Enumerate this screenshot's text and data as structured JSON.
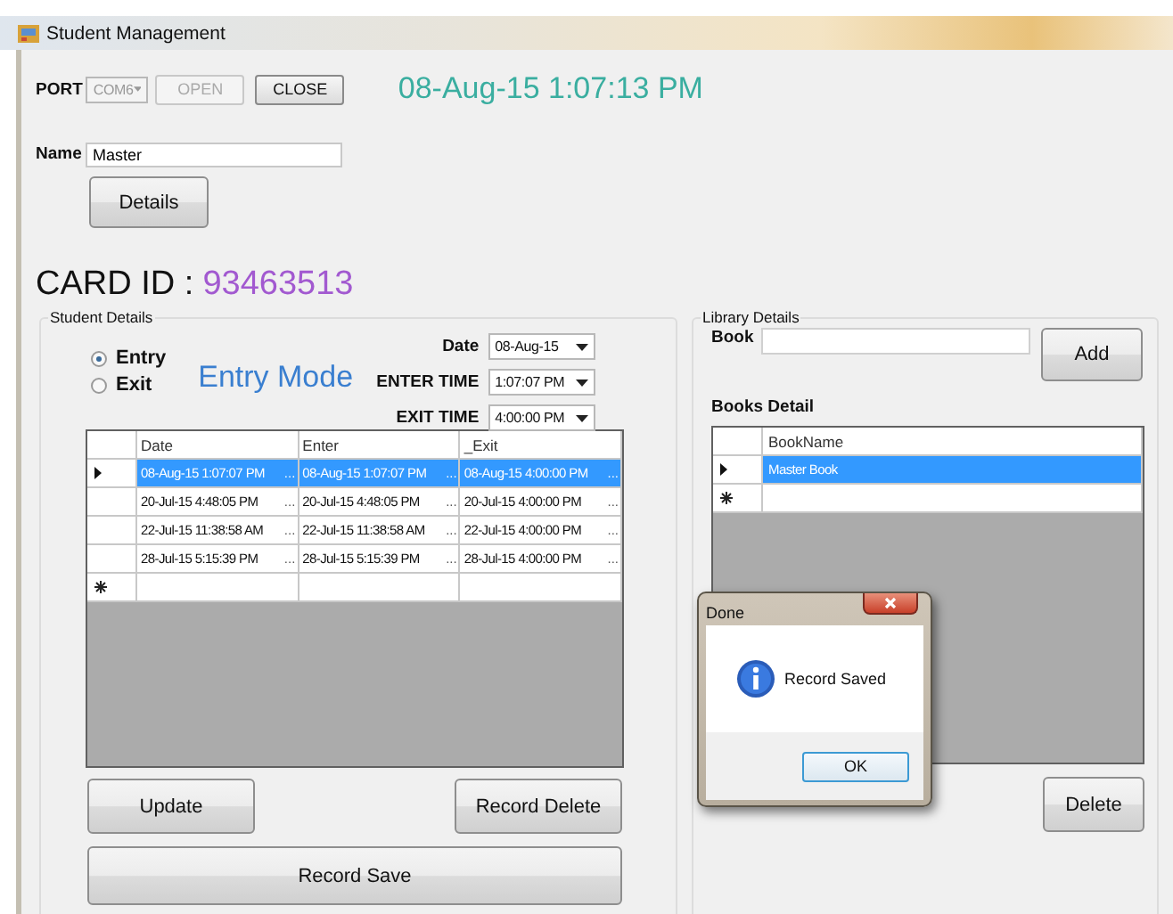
{
  "window": {
    "title": "Student Management"
  },
  "port": {
    "label": "PORT",
    "value": "COM6",
    "disabled": true
  },
  "port_buttons": [
    {
      "label": "OPEN",
      "disabled": true
    },
    {
      "label": "CLOSE",
      "disabled": false
    }
  ],
  "clock": "08-Aug-15 1:07:13 PM",
  "name_field": {
    "label": "Name",
    "value": "Master"
  },
  "details_button": "Details",
  "card_id": {
    "label": "CARD ID :",
    "value": "93463513"
  },
  "student_details": {
    "title": "Student Details",
    "modes": [
      {
        "label": "Entry",
        "selected": true
      },
      {
        "label": "Exit",
        "selected": false
      }
    ],
    "mode_label": "Entry Mode",
    "fields": [
      {
        "label": "Date",
        "value": "08-Aug-15"
      },
      {
        "label": "ENTER TIME",
        "value": "1:07:07 PM"
      },
      {
        "label": "EXIT TIME",
        "value": "4:00:00 PM"
      }
    ],
    "grid": {
      "columns": [
        "Date",
        "Enter",
        "_Exit"
      ],
      "new_row": true,
      "rows": [
        {
          "selected": true,
          "cells": [
            {
              "text": "08-Aug-15 1:07:07 PM",
              "button": "..."
            },
            {
              "text": "08-Aug-15 1:07:07 PM",
              "button": "..."
            },
            {
              "text": "08-Aug-15 4:00:00 PM",
              "button": "..."
            }
          ]
        },
        {
          "selected": false,
          "cells": [
            {
              "text": "20-Jul-15 4:48:05 PM",
              "button": "..."
            },
            {
              "text": "20-Jul-15 4:48:05 PM",
              "button": "..."
            },
            {
              "text": "20-Jul-15 4:00:00 PM",
              "button": "..."
            }
          ]
        },
        {
          "selected": false,
          "cells": [
            {
              "text": "22-Jul-15 11:38:58 AM",
              "button": "..."
            },
            {
              "text": "22-Jul-15 11:38:58 AM",
              "button": "..."
            },
            {
              "text": "22-Jul-15 4:00:00 PM",
              "button": "..."
            }
          ]
        },
        {
          "selected": false,
          "cells": [
            {
              "text": "28-Jul-15 5:15:39 PM",
              "button": "..."
            },
            {
              "text": "28-Jul-15 5:15:39 PM",
              "button": "..."
            },
            {
              "text": "28-Jul-15 4:00:00 PM",
              "button": "..."
            }
          ]
        }
      ]
    },
    "buttons": [
      "Update",
      "Record Delete",
      "Record Save"
    ]
  },
  "library_details": {
    "title": "Library Details",
    "book_label": "Book",
    "add_button": "Add",
    "books_label": "Books Detail",
    "grid": {
      "columns": [
        "BookName"
      ],
      "new_row": true,
      "rows": [
        {
          "selected": true,
          "cells": [
            {
              "text": "Master Book"
            }
          ]
        }
      ]
    },
    "delete_button": "Delete"
  },
  "dialog": {
    "title": "Done",
    "message": "Record Saved",
    "button": "OK"
  }
}
